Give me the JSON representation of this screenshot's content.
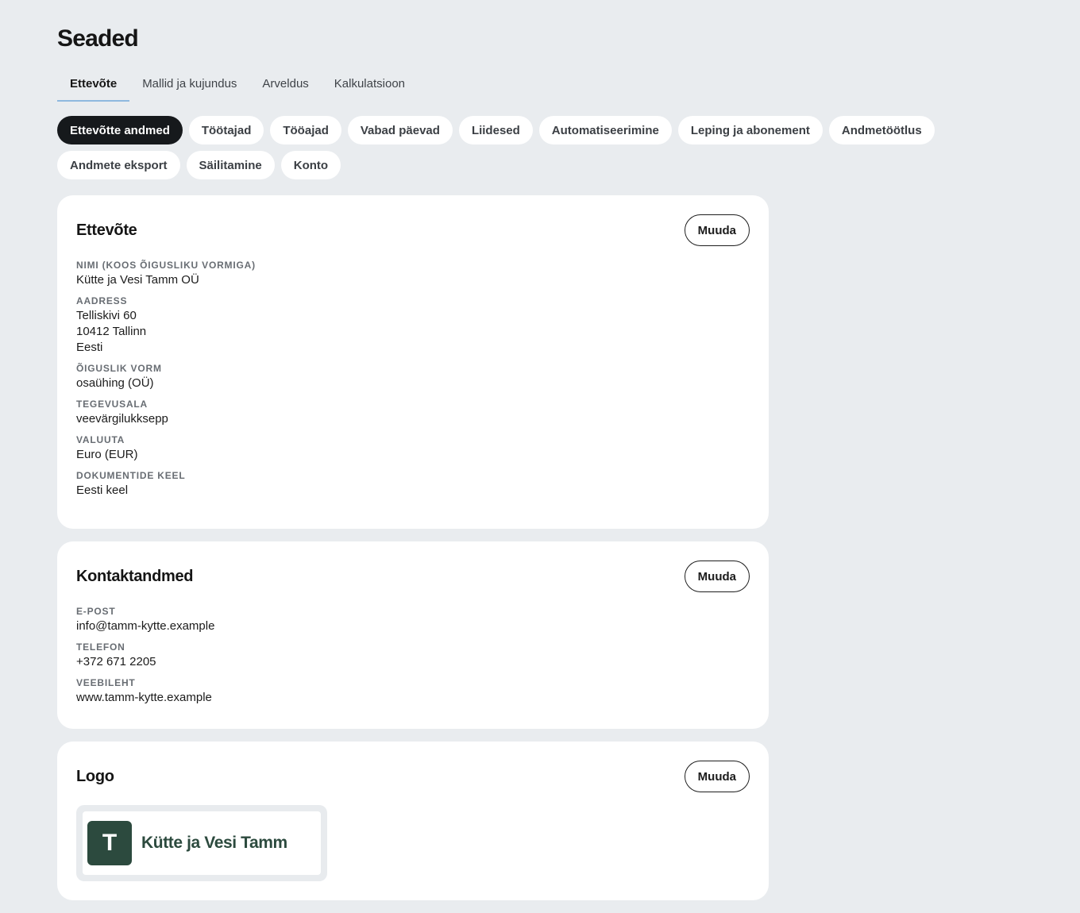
{
  "header": {
    "title": "Seaded"
  },
  "tabs": [
    {
      "label": "Ettevõte",
      "active": true
    },
    {
      "label": "Mallid ja kujundus",
      "active": false
    },
    {
      "label": "Arveldus",
      "active": false
    },
    {
      "label": "Kalkulatsioon",
      "active": false
    }
  ],
  "subnav": [
    {
      "label": "Ettevõtte andmed",
      "active": true
    },
    {
      "label": "Töötajad",
      "active": false
    },
    {
      "label": "Tööajad",
      "active": false
    },
    {
      "label": "Vabad päevad",
      "active": false
    },
    {
      "label": "Liidesed",
      "active": false
    },
    {
      "label": "Automatiseerimine",
      "active": false
    },
    {
      "label": "Leping ja abonement",
      "active": false
    },
    {
      "label": "Andmetöötlus",
      "active": false
    },
    {
      "label": "Andmete eksport",
      "active": false
    },
    {
      "label": "Säilitamine",
      "active": false
    },
    {
      "label": "Konto",
      "active": false
    }
  ],
  "company": {
    "title": "Ettevõte",
    "edit_label": "Muuda",
    "fields": {
      "name": {
        "label": "Nimi (koos õigusliku vormiga)",
        "value": "Kütte ja Vesi Tamm OÜ"
      },
      "address": {
        "label": "Aadress",
        "street": "Telliskivi 60",
        "city": "10412 Tallinn",
        "country": "Eesti"
      },
      "legal_form": {
        "label": "Õiguslik vorm",
        "value": "osaühing (OÜ)"
      },
      "field_of_activity": {
        "label": "Tegevusala",
        "value": "veevärgilukksepp"
      },
      "currency": {
        "label": "Valuuta",
        "value": "Euro (EUR)"
      },
      "document_language": {
        "label": "Dokumentide keel",
        "value": "Eesti keel"
      }
    }
  },
  "contact": {
    "title": "Kontaktandmed",
    "edit_label": "Muuda",
    "fields": {
      "email": {
        "label": "E-post",
        "value": "info@tamm-kytte.example"
      },
      "phone": {
        "label": "Telefon",
        "value": "+372 671 2205"
      },
      "website": {
        "label": "Veebileht",
        "value": "www.tamm-kytte.example"
      }
    }
  },
  "logo": {
    "title": "Logo",
    "edit_label": "Muuda",
    "mark_letter": "T",
    "company_text": "Kütte ja Vesi Tamm",
    "brand_color": "#2c4a3e"
  },
  "colors": {
    "background": "#e9ecef",
    "active_pill": "#16191c",
    "tab_underline": "#8fb9df"
  }
}
